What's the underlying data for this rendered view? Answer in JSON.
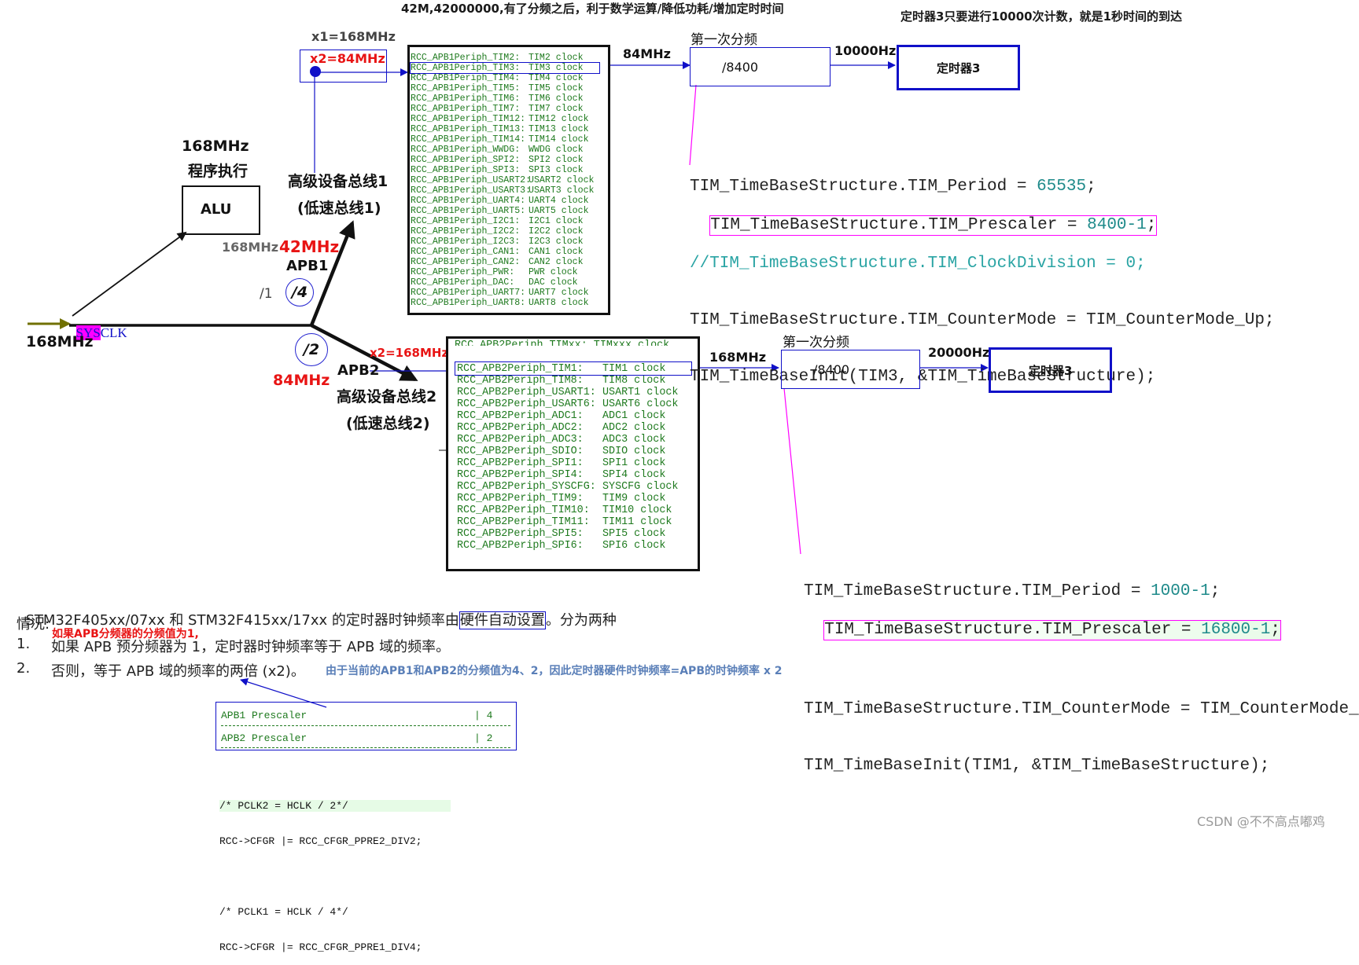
{
  "top_note": "42M,42000000,有了分频之后，利于数学运算/降低功耗/增加定时时间",
  "timer_note": "定时器3只要进行10000次计数，就是1秒时间的到达",
  "alu": {
    "freq": "168MHz",
    "caption": "程序执行",
    "label": "ALU"
  },
  "sysclk": {
    "label_a": "SYS",
    "label_b": "CLK",
    "freq": "168MHz"
  },
  "apb1": {
    "x1": "x1=168MHz",
    "x2": "x2=84MHz",
    "freq_alu": "168MHz",
    "freq": "42MHz",
    "name": "APB1",
    "div_left": "/1",
    "div": "/4",
    "bus": "高级设备总线1",
    "bus_sub": "(低速总线1)",
    "periph": [
      [
        "RCC_APB1Periph_TIM2:",
        "TIM2 clock"
      ],
      [
        "RCC_APB1Periph_TIM3:",
        "TIM3 clock"
      ],
      [
        "RCC_APB1Periph_TIM4:",
        "TIM4 clock"
      ],
      [
        "RCC_APB1Periph_TIM5:",
        "TIM5 clock"
      ],
      [
        "RCC_APB1Periph_TIM6:",
        "TIM6 clock"
      ],
      [
        "RCC_APB1Periph_TIM7:",
        "TIM7 clock"
      ],
      [
        "RCC_APB1Periph_TIM12:",
        "TIM12 clock"
      ],
      [
        "RCC_APB1Periph_TIM13:",
        "TIM13 clock"
      ],
      [
        "RCC_APB1Periph_TIM14:",
        "TIM14 clock"
      ],
      [
        "RCC_APB1Periph_WWDG:",
        "WWDG clock"
      ],
      [
        "RCC_APB1Periph_SPI2:",
        "SPI2 clock"
      ],
      [
        "RCC_APB1Periph_SPI3:",
        "SPI3 clock"
      ],
      [
        "RCC_APB1Periph_USART2:",
        "USART2 clock"
      ],
      [
        "RCC_APB1Periph_USART3:",
        "USART3 clock"
      ],
      [
        "RCC_APB1Periph_UART4:",
        "UART4 clock"
      ],
      [
        "RCC_APB1Periph_UART5:",
        "UART5 clock"
      ],
      [
        "RCC_APB1Periph_I2C1:",
        "I2C1 clock"
      ],
      [
        "RCC_APB1Periph_I2C2:",
        "I2C2 clock"
      ],
      [
        "RCC_APB1Periph_I2C3:",
        "I2C3 clock"
      ],
      [
        "RCC_APB1Periph_CAN1:",
        "CAN1 clock"
      ],
      [
        "RCC_APB1Periph_CAN2:",
        "CAN2 clock"
      ],
      [
        "RCC_APB1Periph_PWR:",
        "PWR clock"
      ],
      [
        "RCC_APB1Periph_DAC:",
        "DAC clock"
      ],
      [
        "RCC_APB1Periph_UART7:",
        "UART7 clock"
      ],
      [
        "RCC_APB1Periph_UART8:",
        "UART8 clock"
      ]
    ],
    "out_freq": "84MHz",
    "first_div_label": "第一次分频",
    "div_value": "/8400",
    "result_freq": "10000Hz",
    "timer": "定时器3",
    "code": {
      "l1a": "TIM_TimeBaseStructure.TIM_Period = ",
      "l1b": "65535",
      "l1c": ";",
      "l2a": "TIM_TimeBaseStructure.TIM_Prescaler = ",
      "l2b": "8400-1",
      "l2c": ";",
      "l3": "//TIM_TimeBaseStructure.TIM_ClockDivision = 0;",
      "l4": "TIM_TimeBaseStructure.TIM_CounterMode = TIM_CounterMode_Up;",
      "l5": "TIM_TimeBaseInit(TIM3, &TIM_TimeBaseStructure);"
    }
  },
  "apb2": {
    "div": "/2",
    "freq": "84MHz",
    "name": "APB2",
    "bus": "高级设备总线2",
    "bus_sub": "(低速总线2)",
    "x2": "x2=168MHz",
    "periph": [
      [
        "RCC_APB2Periph_TIM1:",
        "TIM1 clock"
      ],
      [
        "RCC_APB2Periph_TIM8:",
        "TIM8 clock"
      ],
      [
        "RCC_APB2Periph_USART1:",
        "USART1 clock"
      ],
      [
        "RCC_APB2Periph_USART6:",
        "USART6 clock"
      ],
      [
        "RCC_APB2Periph_ADC1:",
        "ADC1 clock"
      ],
      [
        "RCC_APB2Periph_ADC2:",
        "ADC2 clock"
      ],
      [
        "RCC_APB2Periph_ADC3:",
        "ADC3 clock"
      ],
      [
        "RCC_APB2Periph_SDIO:",
        "SDIO clock"
      ],
      [
        "RCC_APB2Periph_SPI1:",
        "SPI1 clock"
      ],
      [
        "RCC_APB2Periph_SPI4:",
        "SPI4 clock"
      ],
      [
        "RCC_APB2Periph_SYSCFG:",
        "SYSCFG clock"
      ],
      [
        "RCC_APB2Periph_TIM9:",
        "TIM9 clock"
      ],
      [
        "RCC_APB2Periph_TIM10:",
        "TIM10 clock"
      ],
      [
        "RCC_APB2Periph_TIM11:",
        "TIM11 clock"
      ],
      [
        "RCC_APB2Periph_SPI5:",
        "SPI5 clock"
      ],
      [
        "RCC_APB2Periph_SPI6:",
        "SPI6 clock"
      ]
    ],
    "out_freq": "168MHz",
    "first_div_label": "第一次分频",
    "div_value": "/8400",
    "result_freq": "20000Hz",
    "timer": "定时器3",
    "code": {
      "l1a": "TIM_TimeBaseStructure.TIM_Period = ",
      "l1b": "1000-1",
      "l1c": ";",
      "l2a": "TIM_TimeBaseStructure.TIM_Prescaler = ",
      "l2b": "16800-1",
      "l2c": ";",
      "l4": "TIM_TimeBaseStructure.TIM_CounterMode = TIM_CounterMode_Up;",
      "l5": "TIM_TimeBaseInit(TIM1, &TIM_TimeBaseStructure);"
    }
  },
  "doc": {
    "p1a": "STM32F405xx/07xx 和 STM32F415xx/17xx 的定时器时钟频率由",
    "p1b": "硬件自动设置",
    "p1c": "。分为两种",
    "p2": "情况:",
    "red_note": "如果APB分频器的分频值为1,",
    "i1n": "1.",
    "i1": "如果 APB 预分频器为 1，定时器时钟频率等于 APB 域的频率。",
    "i2n": "2.",
    "i2": "否则，等于 APB 域的频率的两倍 (x2)。",
    "i2note": "由于当前的APB1和APB2的分频值为4、2，因此定时器硬件时钟频率=APB的时钟频率 x 2"
  },
  "prescaler_table": [
    {
      "name": "APB1 Prescaler",
      "value": "| 4"
    },
    {
      "name": "APB2 Prescaler",
      "value": "| 2"
    }
  ],
  "code_bottom": [
    "/* PCLK2 = HCLK / 2*/",
    "RCC->CFGR |= RCC_CFGR_PPRE2_DIV2;",
    "",
    "/* PCLK1 = HCLK / 4*/",
    "RCC->CFGR |= RCC_CFGR_PPRE1_DIV4;"
  ],
  "watermark": "CSDN @不不高点嘟鸡",
  "colors": {
    "red": "#e81414",
    "blue": "#1010c8",
    "green": "#1f7a1f",
    "magenta": "#ff00ff",
    "olive": "#707000"
  }
}
